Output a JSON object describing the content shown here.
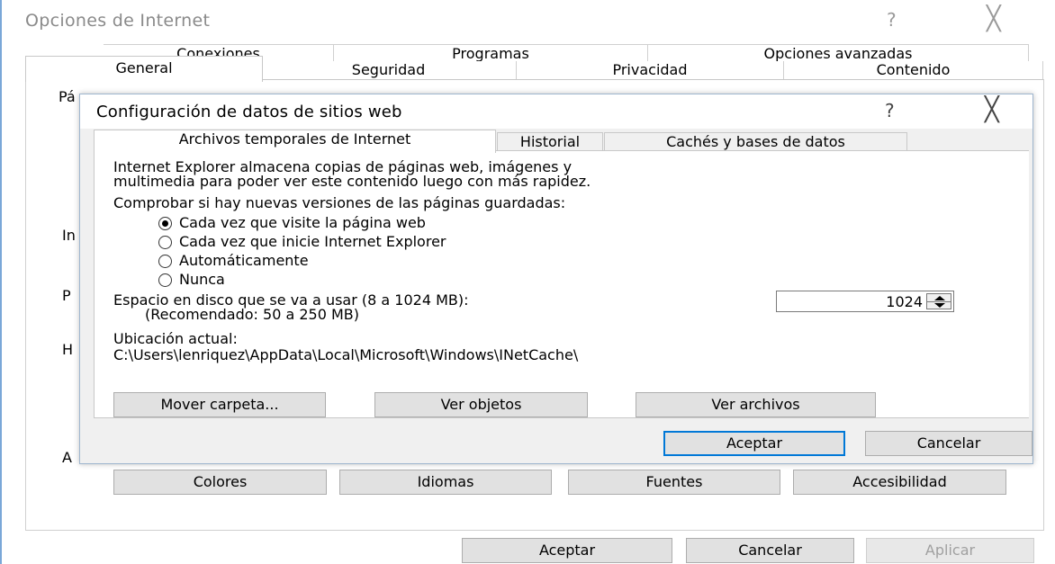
{
  "outer": {
    "title": "Opciones de Internet",
    "help_glyph": "?",
    "close_glyph": "╳",
    "tabs_row1": [
      "Conexiones",
      "Programas",
      "Opciones avanzadas"
    ],
    "tabs_row2": [
      "General",
      "Seguridad",
      "Privacidad",
      "Contenido"
    ],
    "active_tab": "General",
    "peek_letters": [
      "Pá",
      "In",
      "P",
      "H",
      "A"
    ],
    "panel_buttons": [
      "Colores",
      "Idiomas",
      "Fuentes",
      "Accesibilidad"
    ],
    "bottom_buttons": {
      "ok": "Aceptar",
      "cancel": "Cancelar",
      "apply": "Aplicar"
    }
  },
  "dialog": {
    "title": "Configuración de datos de sitios web",
    "help_glyph": "?",
    "close_glyph": "╳",
    "tabs": [
      "Archivos temporales de Internet",
      "Historial",
      "Cachés y bases de datos"
    ],
    "active_tab": "Archivos temporales de Internet",
    "description_line1": "Internet Explorer almacena copias de páginas web, imágenes y",
    "description_line2": "multimedia para poder ver este contenido luego con más rapidez.",
    "check_label": "Comprobar si hay nuevas versiones de las páginas guardadas:",
    "radios": [
      {
        "label": "Cada vez que visite la página web",
        "selected": true
      },
      {
        "label": "Cada vez que inicie Internet Explorer",
        "selected": false
      },
      {
        "label": "Automáticamente",
        "selected": false
      },
      {
        "label": "Nunca",
        "selected": false
      }
    ],
    "disk_label_line1": "Espacio en disco que se va a usar (8 a 1024 MB):",
    "disk_label_line2": "(Recomendado: 50 a 250 MB)",
    "disk_value": "1024",
    "location_label": "Ubicación actual:",
    "location_path": "C:\\Users\\lenriquez\\AppData\\Local\\Microsoft\\Windows\\INetCache\\",
    "buttons": {
      "move": "Mover carpeta...",
      "view_objects": "Ver objetos",
      "view_files": "Ver archivos"
    },
    "ok": "Aceptar",
    "cancel": "Cancelar"
  }
}
